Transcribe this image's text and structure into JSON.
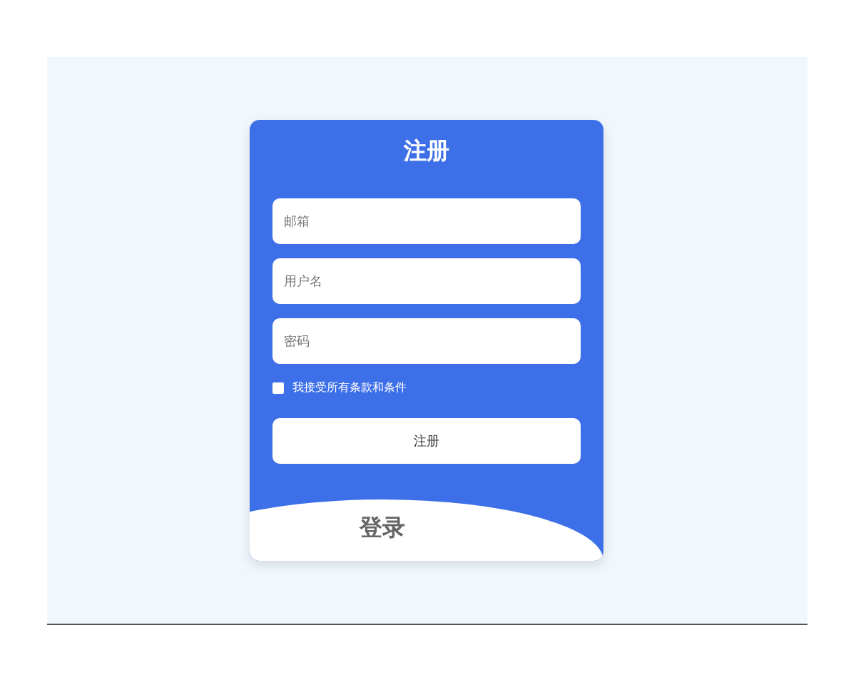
{
  "title": "注册",
  "fields": [
    {
      "placeholder": "邮箱"
    },
    {
      "placeholder": "用户名"
    },
    {
      "placeholder": "密码"
    }
  ],
  "terms": {
    "label": "我接受所有条款和条件",
    "checked": false
  },
  "submit": "注册",
  "login": "登录"
}
